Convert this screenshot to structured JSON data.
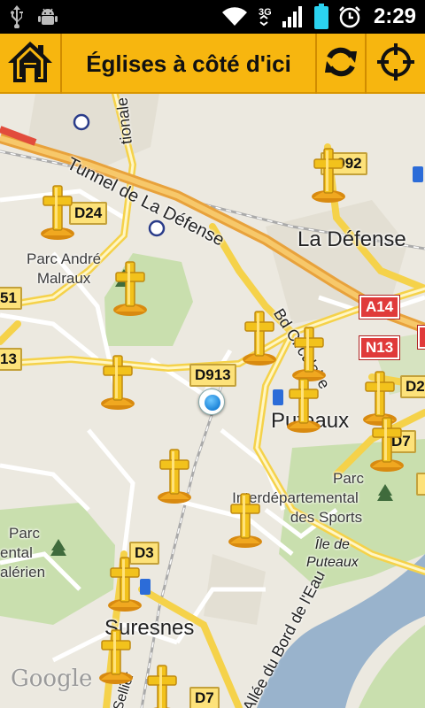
{
  "status_bar": {
    "time": "2:29",
    "icons": [
      "usb-icon",
      "android-debug-icon",
      "wifi-icon",
      "signal-3g-icon",
      "battery-icon",
      "alarm-icon"
    ]
  },
  "action_bar": {
    "title": "Églises à côté d'ici",
    "background": "#f7b60f",
    "home_icon": "home-icon",
    "refresh_icon": "refresh-icon",
    "locate_icon": "crosshair-icon"
  },
  "map": {
    "labels": {
      "tunnel": "Tunnel de La Défense",
      "la_defense": "La Défense",
      "parc_andre_malraux_1": "Parc André",
      "parc_andre_malraux_2": "Malraux",
      "bd_circulaire": "Bd Circulaire",
      "puteaux": "Puteaux",
      "parc_inter_1": "Parc",
      "parc_inter_2": "Interdépartemental",
      "parc_inter_3": "des Sports",
      "ile_puteaux_1": "Île de",
      "ile_puteaux_2": "Puteaux",
      "parc_valerien_1": "Parc",
      "parc_valerien_2": "ental",
      "parc_valerien_3": "alérien",
      "suresnes": "Suresnes",
      "allee_bord_eau": "Allée du Bord de l'Eau",
      "nationale": "tionale",
      "sellier": "Sellier",
      "google": "Google"
    },
    "shields": {
      "d992": "D992",
      "d24": "D24",
      "d913": "D913",
      "d913_left": "13",
      "d_left_top": "51",
      "a14": "A14",
      "n13": "N13",
      "d2": "D2",
      "d7": "D7",
      "d3": "D3",
      "d7_bottom": "D7"
    },
    "marker_icon": "church-cross-icon",
    "church_count": 14,
    "my_location_icon": "my-location-dot-icon"
  }
}
